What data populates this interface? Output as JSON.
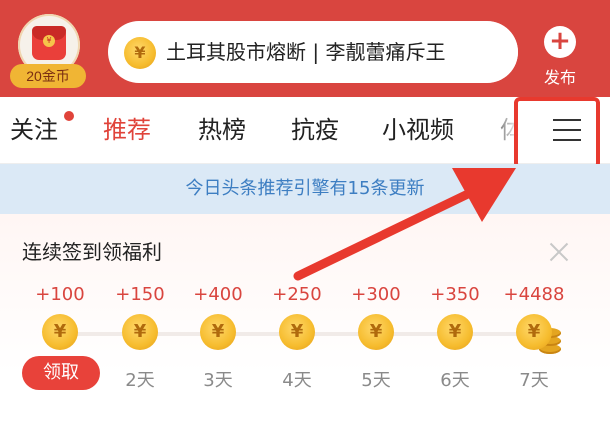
{
  "header": {
    "gold_badge_label": "20金币",
    "coin_icon_glyph": "¥",
    "search_text": "土耳其股市熔断 | 李靓蕾痛斥王",
    "publish_icon_glyph": "+",
    "publish_label": "发布",
    "background_color": "#d9453f"
  },
  "tabs": {
    "items": [
      {
        "label": "关注",
        "has_dot": true
      },
      {
        "label": "推荐",
        "active": true
      },
      {
        "label": "热榜"
      },
      {
        "label": "抗疫"
      },
      {
        "label": "小视频"
      },
      {
        "label": "体"
      }
    ],
    "menu_icon": "hamburger-menu-icon",
    "accent_color": "#e0433a"
  },
  "banner": {
    "text": "今日头条推荐引擎有15条更新"
  },
  "checkin": {
    "title": "连续签到领福利",
    "claim_label": "领取",
    "days": [
      {
        "reward": "+100",
        "label": "领取"
      },
      {
        "reward": "+150",
        "label": "2天"
      },
      {
        "reward": "+400",
        "label": "3天"
      },
      {
        "reward": "+250",
        "label": "4天"
      },
      {
        "reward": "+300",
        "label": "5天"
      },
      {
        "reward": "+350",
        "label": "6天"
      },
      {
        "reward": "+4488",
        "label": "7天"
      }
    ]
  }
}
